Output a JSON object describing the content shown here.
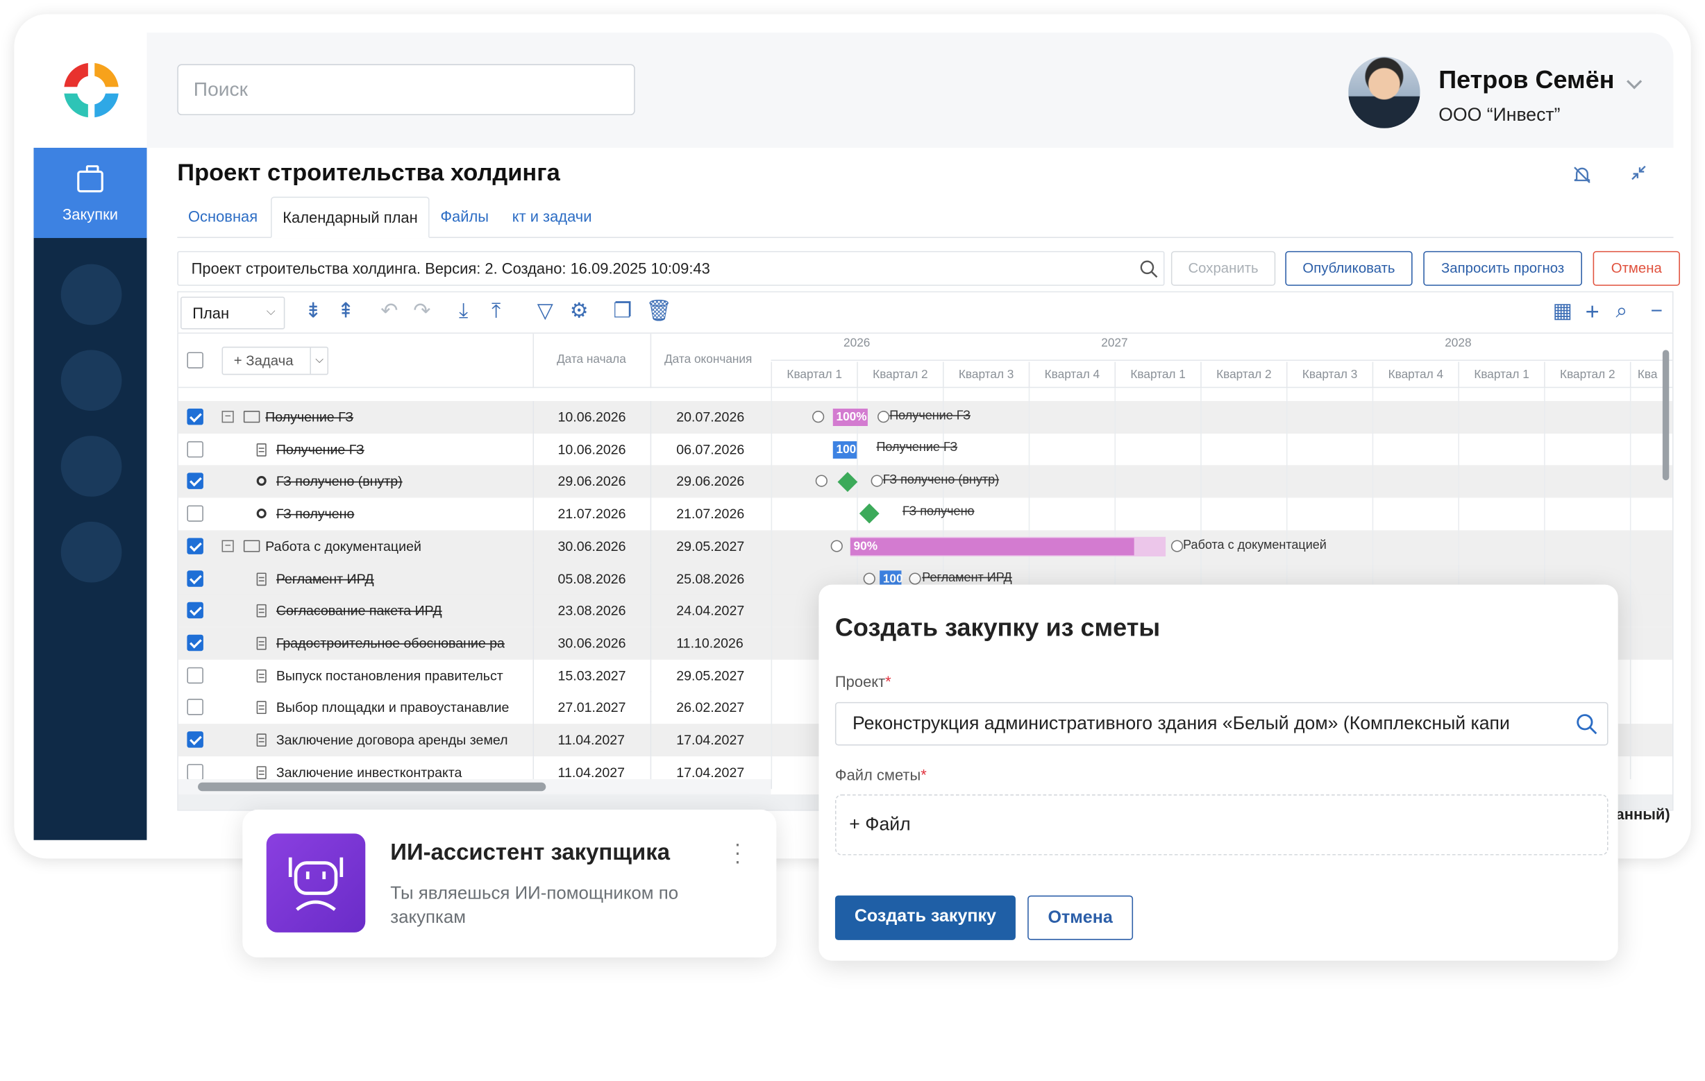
{
  "app": {
    "section": "Закупки"
  },
  "search": {
    "placeholder": "Поиск"
  },
  "user": {
    "name": "Петров Семён",
    "org": "ООО “Инвест”"
  },
  "project": {
    "title": "Проект строительства холдинга",
    "tabs": [
      {
        "label": "Основная"
      },
      {
        "label": "Календарный план"
      },
      {
        "label": "Файлы"
      },
      {
        "label": "кт и задачи"
      }
    ],
    "version": "Проект строительства холдинга. Версия: 2. Создано: 16.09.2025 10:09:43"
  },
  "actions": {
    "save": "Сохранить",
    "publish": "Опубликовать",
    "forecast": "Запросить прогноз",
    "cancel": "Отмена"
  },
  "toolbar": {
    "view": "План",
    "add_task": "+ Задача"
  },
  "columns": {
    "start": "Дата начала",
    "end": "Дата окончания"
  },
  "timeline": {
    "years": [
      "2026",
      "2027",
      "2028"
    ],
    "quarters": [
      "Квартал 1",
      "Квартал 2",
      "Квартал 3",
      "Квартал 4",
      "Квартал 1",
      "Квартал 2",
      "Квартал 3",
      "Квартал 4",
      "Квартал 1",
      "Квартал 2",
      "Ква"
    ]
  },
  "tasks": [
    {
      "name": "Получение ГЗ",
      "start": "10.06.2026",
      "end": "20.07.2026",
      "checked": true,
      "struck": true,
      "type": "folder"
    },
    {
      "name": "Получение ГЗ",
      "start": "10.06.2026",
      "end": "06.07.2026",
      "checked": false,
      "struck": true,
      "type": "task"
    },
    {
      "name": "ГЗ получено (внутр)",
      "start": "29.06.2026",
      "end": "29.06.2026",
      "checked": true,
      "struck": true,
      "type": "milestone"
    },
    {
      "name": "ГЗ получено",
      "start": "21.07.2026",
      "end": "21.07.2026",
      "checked": false,
      "struck": true,
      "type": "milestone"
    },
    {
      "name": "Работа с документацией",
      "start": "30.06.2026",
      "end": "29.05.2027",
      "checked": true,
      "struck": false,
      "type": "folder"
    },
    {
      "name": "Регламент ИРД",
      "start": "05.08.2026",
      "end": "25.08.2026",
      "checked": true,
      "struck": true,
      "type": "task"
    },
    {
      "name": "Согласование пакета ИРД",
      "start": "23.08.2026",
      "end": "24.04.2027",
      "checked": true,
      "struck": true,
      "type": "task"
    },
    {
      "name": "Градостроительное обоснование ра",
      "start": "30.06.2026",
      "end": "11.10.2026",
      "checked": true,
      "struck": true,
      "type": "task"
    },
    {
      "name": "Выпуск постановления правительст",
      "start": "15.03.2027",
      "end": "29.05.2027",
      "checked": false,
      "struck": false,
      "type": "task"
    },
    {
      "name": "Выбор площадки и правоустанавлие",
      "start": "27.01.2027",
      "end": "26.02.2027",
      "checked": false,
      "struck": false,
      "type": "task"
    },
    {
      "name": "Заключение договора аренды земел",
      "start": "11.04.2027",
      "end": "17.04.2027",
      "checked": true,
      "struck": false,
      "type": "task"
    },
    {
      "name": "Заключение инвестконтракта",
      "start": "11.04.2027",
      "end": "17.04.2027",
      "checked": false,
      "struck": false,
      "type": "task"
    }
  ],
  "gantt": {
    "bar1": "100%",
    "bar1_label": "Получение ГЗ",
    "bar2": "100",
    "bar2_label": "Получение ГЗ",
    "m1_label": "ГЗ получено (внутр)",
    "m2_label": "ГЗ получено",
    "bar3": "90%",
    "bar3_label": "Работа с документацией",
    "bar4": "100",
    "bar4_label": "Регламент ИРД",
    "progress_pct": 90
  },
  "behind": {
    "text": "анный)"
  },
  "modal": {
    "title": "Создать закупку из сметы",
    "project_label": "Проект",
    "project_value": "Реконструкция административного здания «Белый дом» (Комплексный капи",
    "file_label": "Файл сметы",
    "file_button": "+ Файл",
    "submit": "Создать закупку",
    "cancel": "Отмена"
  },
  "assistant": {
    "title": "ИИ-ассистент закупщика",
    "subtitle": "Ты являешься ИИ-помощником по закупкам"
  },
  "colors": {
    "accent": "#3d82e2",
    "sidebar": "#0f2a47",
    "primary_btn": "#1f5fa6",
    "danger": "#e0513d",
    "bar_pink": "#d37bd0",
    "bar_blue": "#3d82e2"
  }
}
